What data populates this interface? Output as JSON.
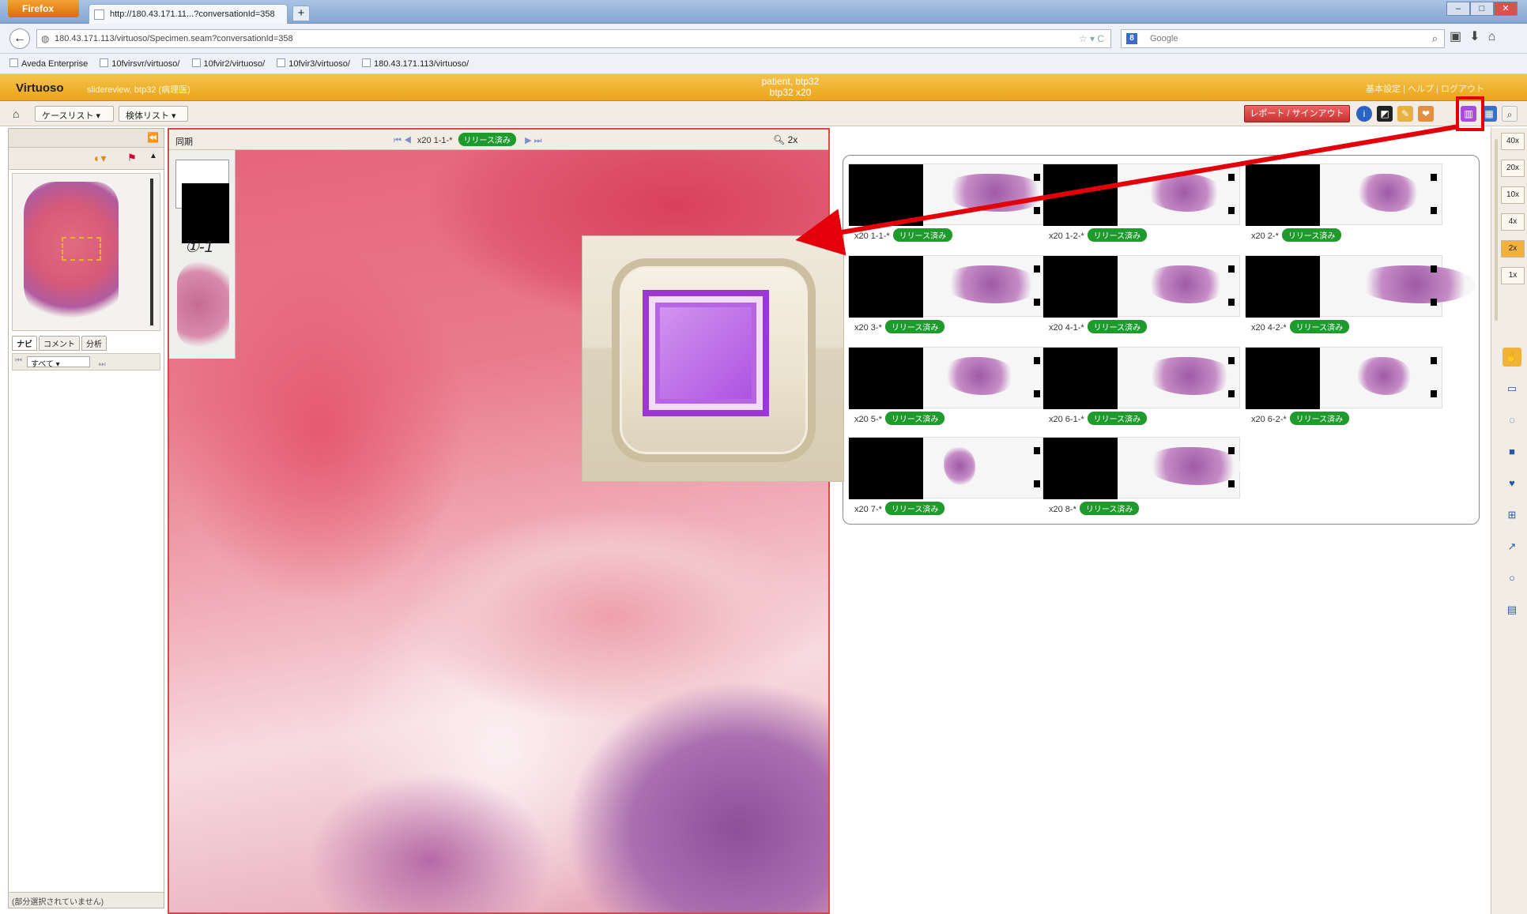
{
  "browser": {
    "app_button": "Firefox",
    "tab_title": "http://180.43.171.11...?conversationId=358",
    "new_tab": "+",
    "url": "180.43.171.113/virtuoso/Specimen.seam?conversationId=358",
    "search_engine": "Google",
    "bookmarks": [
      "Aveda Enterprise",
      "10fvirsvr/virtuoso/",
      "10fvir2/virtuoso/",
      "10fvir3/virtuoso/",
      "180.43.171.113/virtuoso/"
    ]
  },
  "app": {
    "logo": "Virtuoso",
    "subtitle": "slidereview, btp32 (病理医)",
    "patient_line1": "patient, btp32",
    "patient_line2": "btp32 x20",
    "header_links": "基本設定 | ヘルプ | ログアウト",
    "accent": "#eba51b"
  },
  "toolbar": {
    "case_list": "ケースリスト",
    "specimen_list": "検体リスト",
    "report_button": "レポート / サインアウト",
    "icons": [
      "info-icon",
      "color-icon",
      "annotation-icon",
      "tag-icon",
      "slide-tray-icon",
      "grid-icon",
      "search-icon"
    ]
  },
  "left_panel": {
    "tabs": [
      "ナビ",
      "コメント",
      "分析"
    ],
    "filter_value": "すべて",
    "footer": "(部分選択されていません)"
  },
  "viewer": {
    "sync_label": "同期",
    "slide_name": "x20 1-1-*",
    "release_label": "リリース済み",
    "zoom": "2x",
    "slide_label_text": "①-1"
  },
  "slides": [
    {
      "label": "x20 1-1-*",
      "status": "リリース済み"
    },
    {
      "label": "x20 1-2-*",
      "status": "リリース済み"
    },
    {
      "label": "x20 2-*",
      "status": "リリース済み"
    },
    {
      "label": "x20 3-*",
      "status": "リリース済み"
    },
    {
      "label": "x20 4-1-*",
      "status": "リリース済み"
    },
    {
      "label": "x20 4-2-*",
      "status": "リリース済み"
    },
    {
      "label": "x20 5-*",
      "status": "リリース済み"
    },
    {
      "label": "x20 6-1-*",
      "status": "リリース済み"
    },
    {
      "label": "x20 6-2-*",
      "status": "リリース済み"
    },
    {
      "label": "x20 7-*",
      "status": "リリース済み"
    },
    {
      "label": "x20 8-*",
      "status": "リリース済み"
    }
  ],
  "zoom_levels": [
    "40x",
    "20x",
    "10x",
    "4x",
    "2x",
    "1x"
  ],
  "selected_zoom": "2x",
  "right_tools": [
    "pan-icon",
    "rectangle-icon",
    "lasso-icon",
    "fill-rect-icon",
    "blob-icon",
    "ruler-icon",
    "arrow-icon",
    "circle-icon",
    "text-box-icon"
  ],
  "callout": {
    "icon": "slide-tray-icon",
    "highlight_color": "#e3000b",
    "icon_color": "#a84ce0"
  }
}
